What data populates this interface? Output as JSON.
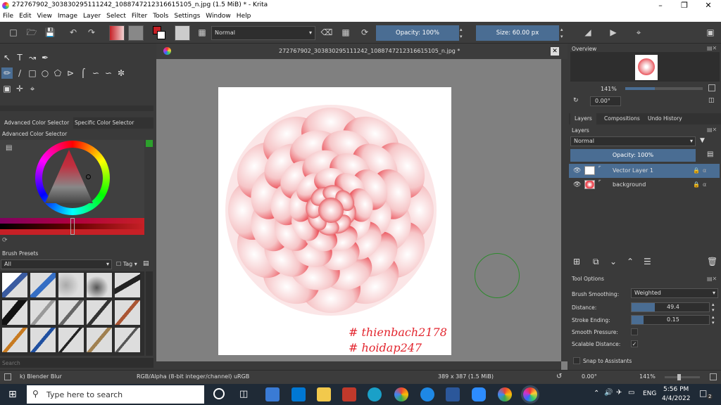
{
  "window": {
    "title": "272767902_303830295111242_1088747212316615105_n.jpg (1.5 MiB)  * - Krita"
  },
  "menu": [
    "File",
    "Edit",
    "View",
    "Image",
    "Layer",
    "Select",
    "Filter",
    "Tools",
    "Settings",
    "Window",
    "Help"
  ],
  "toolbar": {
    "blend_mode": "Normal",
    "opacity_label": "Opacity: 100%",
    "size_label": "Size: 60.00 px"
  },
  "left": {
    "color_tabs": [
      "Advanced Color Selector",
      "Specific Color Selector"
    ],
    "color_header": "Advanced Color Selector",
    "presets_header": "Brush Presets",
    "presets_filter": "All",
    "tag_label": "Tag",
    "search_placeholder": "Search"
  },
  "document": {
    "tab_title": "272767902_303830295111242_1088747212316615105_n.jpg *",
    "watermark_line1": "# thienbach2178",
    "watermark_line2": "# hoidap247"
  },
  "right": {
    "overview_header": "Overview",
    "zoom": "141%",
    "rotation": "0.00°",
    "tabs": [
      "Layers",
      "Compositions",
      "Undo History"
    ],
    "layers_header": "Layers",
    "layers_blend": "Normal",
    "layers_opacity": "Opacity:  100%",
    "layers": [
      {
        "name": "Vector Layer 1",
        "selected": true
      },
      {
        "name": "background",
        "selected": false
      }
    ],
    "tool_options_header": "Tool Options",
    "options": [
      {
        "label": "Brush Smoothing:",
        "value": "Weighted"
      },
      {
        "label": "Distance:",
        "value": "49.4"
      },
      {
        "label": "Stroke Ending:",
        "value": "0.15"
      },
      {
        "label": "Smooth Pressure:",
        "value": ""
      },
      {
        "label": "Scalable Distance:",
        "value": "✓"
      }
    ],
    "distance_fraction": 0.3,
    "stroke_fraction": 0.15,
    "snap_label": "Snap to Assistants"
  },
  "status": {
    "preset": "k) Blender Blur",
    "colorspace": "RGB/Alpha (8-bit integer/channel)  uRGB",
    "dimensions": "389 x 387 (1.5 MiB)",
    "rotation": "0.00°",
    "zoom": "141%"
  },
  "taskbar": {
    "search_placeholder": "Type here to search",
    "language": "ENG",
    "time": "5:56 PM",
    "date": "4/4/2022",
    "notification_count": "2"
  },
  "colors": {
    "accent": "#4a6d93",
    "flower": "#e8323c",
    "fg_color": "#c62026"
  }
}
